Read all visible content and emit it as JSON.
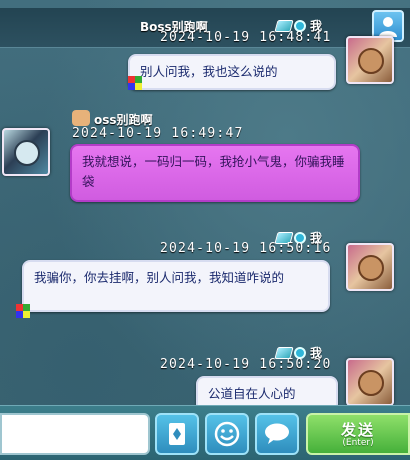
{
  "header": {
    "peer_name": "Boss别跑啊",
    "me_label": "我"
  },
  "messages": [
    {
      "sender": "我",
      "time": "2024-10-19  16:48:41",
      "text": "别人问我，我也这么说的",
      "side": "right"
    },
    {
      "sender": "Boss别跑啊",
      "time": "2024-10-19  16:49:47",
      "text": "我就想说，一码归一码，我抢小气鬼，你骗我睡袋",
      "side": "left"
    },
    {
      "sender": "我",
      "time": "2024-10-19  16:50:16",
      "text": "我骗你，你去挂啊，别人问我，我知道咋说的",
      "side": "right"
    },
    {
      "sender": "我",
      "time": "2024-10-19  16:50:20",
      "text": "公道自在人心的",
      "side": "right"
    }
  ],
  "left_msg_name_partial": "oss别跑啊",
  "input": {
    "value": "",
    "placeholder": ""
  },
  "toolbar": {
    "card_icon": "card-icon",
    "emoji_icon": "smiley-icon",
    "chat_icon": "speech-bubble-icon"
  },
  "send_button": {
    "label": "发送",
    "shortcut": "(Enter)"
  },
  "colors": {
    "background": "#3f6978",
    "bubble_default": "#f3f4fb",
    "bubble_purple": "#d05ce0",
    "send_green": "#45b03a",
    "tool_blue": "#2f8dbd"
  }
}
